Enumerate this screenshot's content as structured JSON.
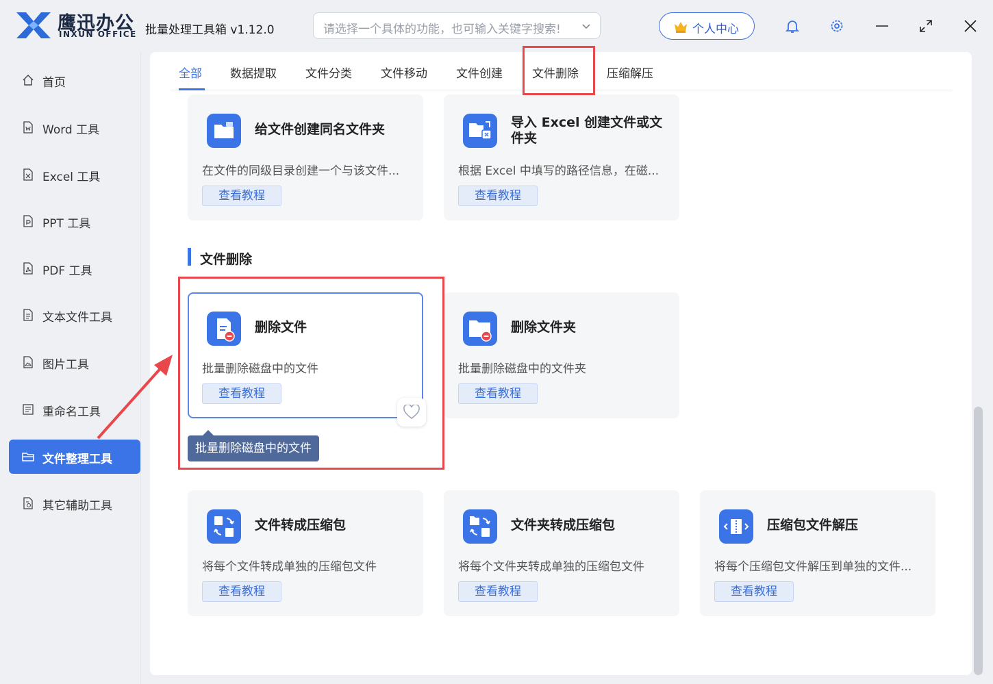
{
  "app": {
    "brand_cn": "鹰迅办公",
    "brand_en": "INXUN OFFICE",
    "title": "批量处理工具箱 v1.12.0",
    "search_placeholder": "请选择一个具体的功能，也可输入关键字搜索!",
    "user_center": "个人中心"
  },
  "sidebar": {
    "items": [
      {
        "label": "首页",
        "icon": "home-icon"
      },
      {
        "label": "Word 工具",
        "icon": "word-file-icon"
      },
      {
        "label": "Excel 工具",
        "icon": "excel-file-icon"
      },
      {
        "label": "PPT 工具",
        "icon": "ppt-file-icon"
      },
      {
        "label": "PDF 工具",
        "icon": "pdf-file-icon"
      },
      {
        "label": "文本文件工具",
        "icon": "text-file-icon"
      },
      {
        "label": "图片工具",
        "icon": "image-file-icon"
      },
      {
        "label": "重命名工具",
        "icon": "rename-icon"
      },
      {
        "label": "文件整理工具",
        "icon": "folder-icon",
        "active": true
      },
      {
        "label": "其它辅助工具",
        "icon": "tools-icon"
      }
    ]
  },
  "tabs": [
    "全部",
    "数据提取",
    "文件分类",
    "文件移动",
    "文件创建",
    "文件删除",
    "压缩解压"
  ],
  "cards_top": [
    {
      "title": "给文件创建同名文件夹",
      "desc": "在文件的同级目录创建一个与该文件...",
      "btn": "查看教程",
      "icon": "folder-create-icon"
    },
    {
      "title": "导入 Excel 创建文件或文件夹",
      "desc": "根据 Excel 中填写的路径信息，在磁...",
      "btn": "查看教程",
      "icon": "excel-import-icon"
    }
  ],
  "section_delete": "文件删除",
  "cards_delete": [
    {
      "title": "删除文件",
      "desc": "批量删除磁盘中的文件",
      "btn": "查看教程",
      "icon": "delete-file-icon"
    },
    {
      "title": "删除文件夹",
      "desc": "批量删除磁盘中的文件夹",
      "btn": "查看教程",
      "icon": "delete-folder-icon"
    }
  ],
  "tooltip": "批量删除磁盘中的文件",
  "cards_compress": [
    {
      "title": "文件转成压缩包",
      "desc": "将每个文件转成单独的压缩包文件",
      "btn": "查看教程",
      "icon": "file-to-zip-icon"
    },
    {
      "title": "文件夹转成压缩包",
      "desc": "将每个文件夹转成单独的压缩包文件",
      "btn": "查看教程",
      "icon": "folder-to-zip-icon"
    },
    {
      "title": "压缩包文件解压",
      "desc": "将每个压缩包文件解压到单独的文件...",
      "btn": "查看教程",
      "icon": "unzip-icon"
    }
  ],
  "colors": {
    "accent": "#3b74e6",
    "highlight": "#e8474b"
  }
}
